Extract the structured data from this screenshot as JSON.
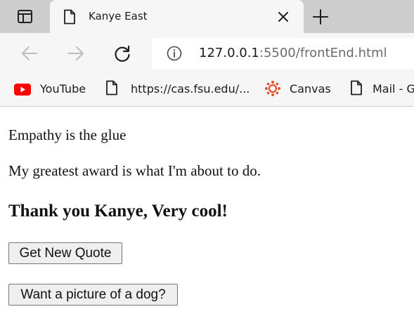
{
  "browser": {
    "tab": {
      "title": "Kanye East"
    },
    "address_bar": {
      "url_host": "127.0.0.1",
      "url_rest": ":5500/frontEnd.html"
    },
    "bookmarks": [
      {
        "label": "YouTube",
        "icon": "youtube-icon"
      },
      {
        "label": "https://cas.fsu.edu/...",
        "icon": "page-icon"
      },
      {
        "label": "Canvas",
        "icon": "canvas-icon"
      },
      {
        "label": "Mail - G",
        "icon": "page-icon"
      }
    ],
    "colors": {
      "tabstrip": "#cdcdcd",
      "toolbar": "#f6f6f6",
      "youtube_red": "#ff0000",
      "canvas_red": "#e4502d"
    }
  },
  "page": {
    "quote_1": "Empathy is the glue",
    "quote_2": "My greatest award is what I'm about to do.",
    "thanks_heading": "Thank you Kanye, Very cool!",
    "new_quote_button": "Get New Quote",
    "dog_button": "Want a picture of a dog?"
  }
}
